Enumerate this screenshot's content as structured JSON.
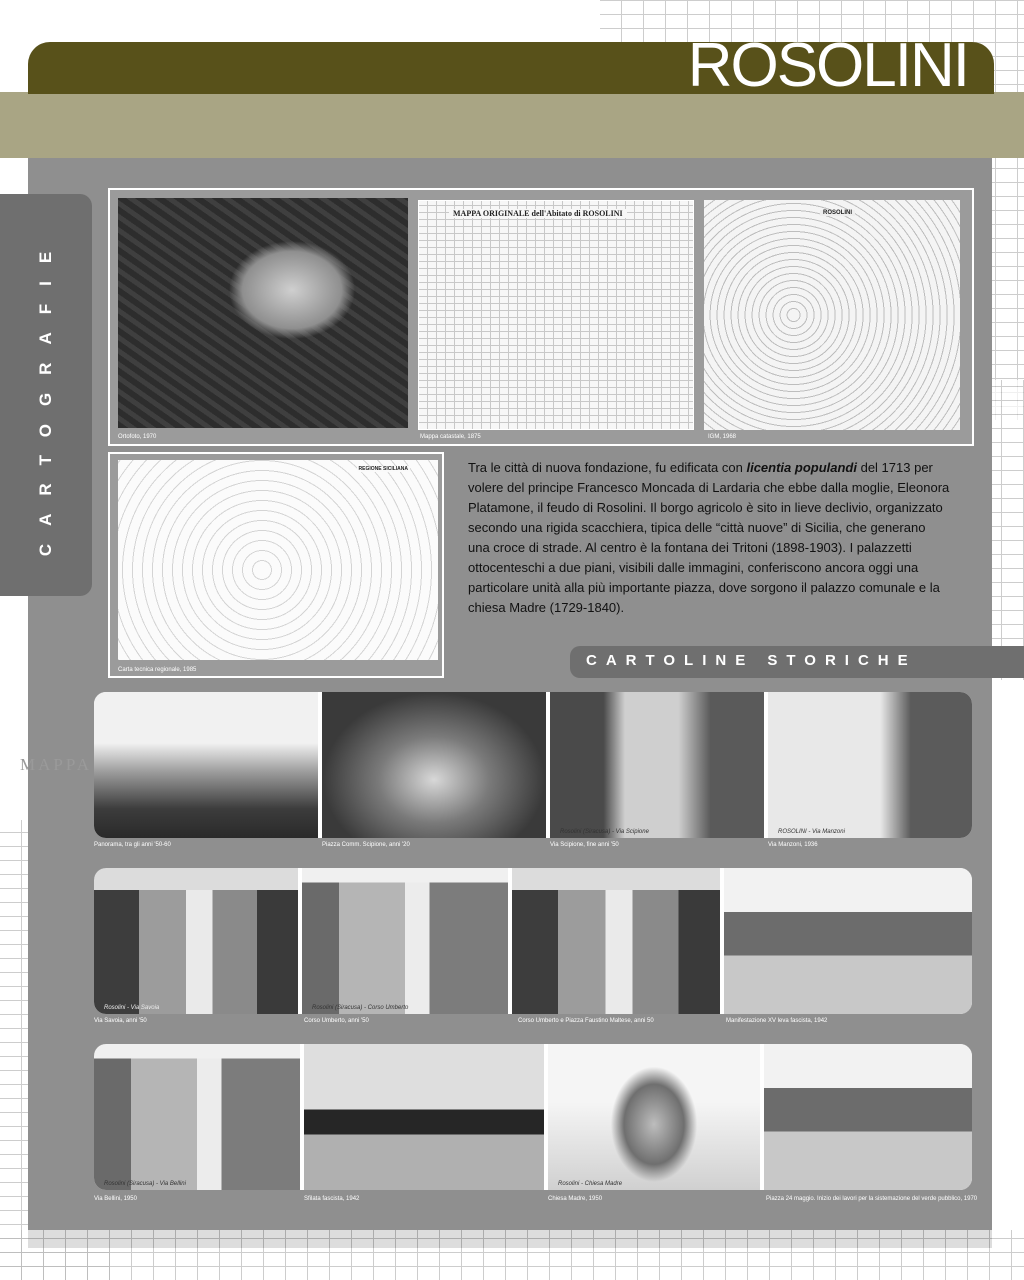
{
  "header": {
    "title": "ROSOLINI"
  },
  "side_tab": {
    "label": "CARTOGRAFIE"
  },
  "background": {
    "mappa_label": "MAPPA"
  },
  "maps": [
    {
      "caption": "Ortofoto, 1970"
    },
    {
      "caption": "Mappa catastale, 1875",
      "inner_title": "MAPPA ORIGINALE dell'Abitato di ROSOLINI"
    },
    {
      "caption": "IGM, 1968",
      "inner_title": "ROSOLINI"
    },
    {
      "caption": "Carta tecnica regionale, 1985",
      "inner_title": "REGIONE SICILIANA"
    }
  ],
  "body": {
    "p1": "Tra le città di nuova fondazione, fu edificata con ",
    "emph": "licentia populandi",
    "p2": " del 1713 per volere del principe Francesco Moncada di Lardaria che ebbe dalla moglie, Eleonora Platamone,  il feudo di Rosolini. Il borgo agricolo è sito in lieve declivio, organizzato secondo una rigida scacchiera, tipica delle “città nuove” di Sicilia, che generano una croce di strade. Al centro è la fontana dei Tritoni (1898-1903). I palazzetti ottocenteschi a due piani, visibili dalle immagini, conferiscono ancora oggi una particolare unità alla più importante piazza, dove sorgono il palazzo comunale e la chiesa Madre (1729-1840)."
  },
  "postcards": {
    "section_title": "CARTOLINE STORICHE",
    "row1": [
      {
        "caption": "Panorama, tra gli anni '50-60"
      },
      {
        "caption": "Piazza Comm. Scipione, anni '20"
      },
      {
        "caption": "Via Scipione, fine anni '50",
        "inner": "Rosolini (Siracusa) - Via Scipione"
      },
      {
        "caption": "Via Manzoni, 1936",
        "inner": "ROSOLINI - Via Manzoni"
      }
    ],
    "row2": [
      {
        "caption": "Via Savoia, anni '50",
        "inner": "Rosolini - Via Savoia"
      },
      {
        "caption": "Corso Umberto, anni '50",
        "inner": "Rosolini (Siracusa) - Corso Umberto"
      },
      {
        "caption": "Corso Umberto e Piazza Faustino Maltese, anni 50"
      },
      {
        "caption": "Manifestazione XV leva fascista, 1942"
      }
    ],
    "row3": [
      {
        "caption": "Via Bellini, 1950",
        "inner": "Rosolini (Siracusa) - Via Bellini"
      },
      {
        "caption": "Sfilata fascista, 1942"
      },
      {
        "caption": "Chiesa Madre, 1950",
        "inner": "Rosolini - Chiesa Madre"
      },
      {
        "caption": "Piazza 24 maggio. Inizio dei lavori per la sistemazione del verde pubblico, 1970"
      }
    ]
  }
}
